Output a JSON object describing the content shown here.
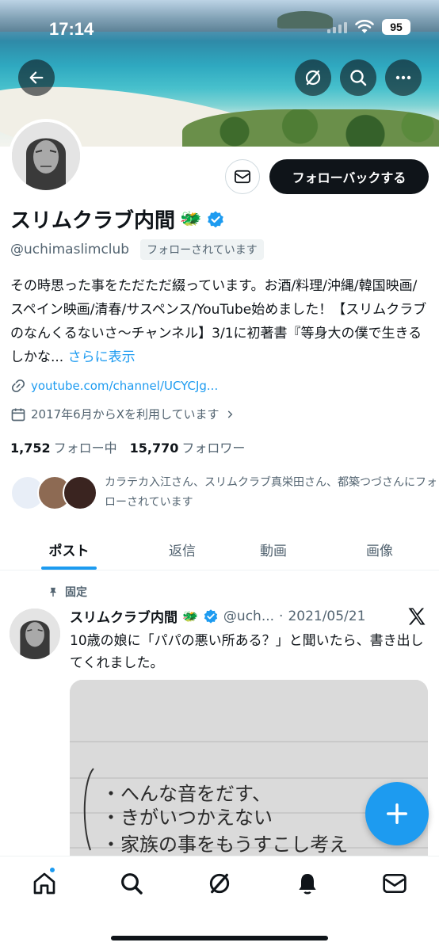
{
  "status_bar": {
    "time": "17:14",
    "battery": "95"
  },
  "profile": {
    "display_name": "スリムクラブ内間",
    "emoji": "🐲",
    "handle": "@uchimaslimclub",
    "follows_you": "フォローされています",
    "follow_back": "フォローバックする",
    "bio_text": "その時思った事をただただ綴っています。お酒/料理/沖縄/韓国映画/スペイン映画/清春/サスペンス/YouTube始めました！【スリムクラブのなんくるないさ〜チャンネル】3/1に初著書『等身大の僕で生きるしかな... ",
    "bio_more": "さらに表示",
    "link": "youtube.com/channel/UCYCJg...",
    "joined": "2017年6月からXを利用しています",
    "following_count": "1,752",
    "following_label": "フォロー中",
    "followers_count": "15,770",
    "followers_label": "フォロワー",
    "followed_by_text": "カラテカ入江さん、スリムクラブ真栄田さん、都築つづさんにフォローされています"
  },
  "tabs": [
    {
      "label": "ポスト"
    },
    {
      "label": "返信"
    },
    {
      "label": "動画"
    },
    {
      "label": "画像"
    }
  ],
  "post": {
    "pinned_label": "固定",
    "name": "スリムクラブ内間",
    "emoji": "🐲",
    "handle": "@uch...",
    "separator": "·",
    "date": "2021/05/21",
    "text": "10歳の娘に「パパの悪い所ある？」と聞いたら、書き出してくれました。",
    "image_lines": [
      "・へんな音をだす、",
      "・きがいつかえない",
      "・家族の事をもうすこし考え"
    ]
  },
  "icons": {
    "back": "back-arrow-icon",
    "grok": "grok-icon",
    "search": "search-icon",
    "more": "more-icon",
    "mail": "mail-icon",
    "verified": "verified-badge-icon",
    "link": "link-icon",
    "calendar": "calendar-icon",
    "pin": "pin-icon",
    "x_logo": "x-logo-icon",
    "compose": "plus-icon",
    "nav": [
      "home-icon",
      "search-icon",
      "grok-icon",
      "bell-icon",
      "mail-icon"
    ]
  },
  "colors": {
    "accent": "#1d9bf0",
    "text": "#0f1419",
    "muted": "#536471",
    "verified": "#1d9bf0"
  }
}
